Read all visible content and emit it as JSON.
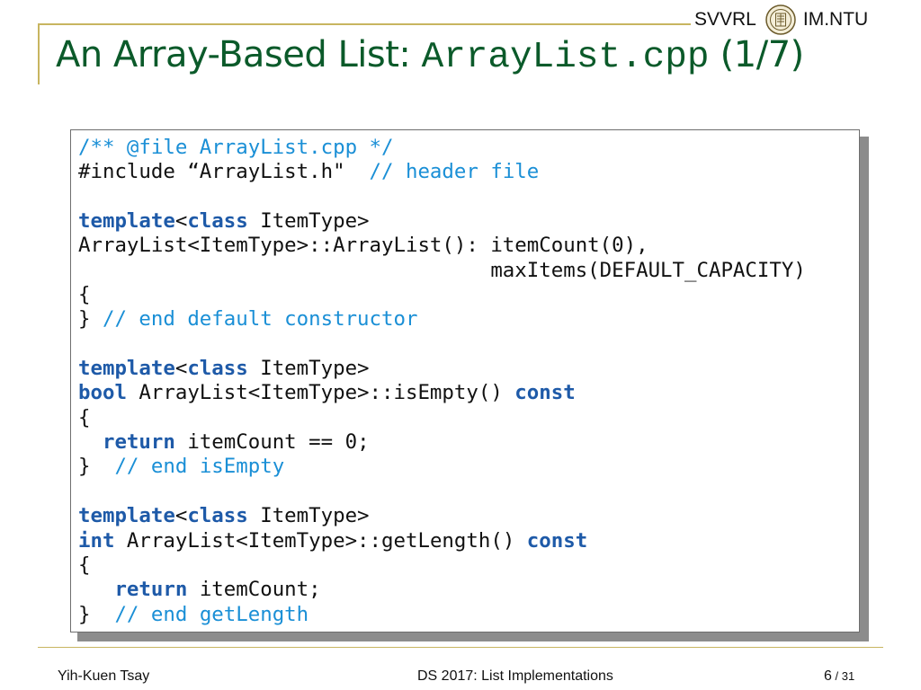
{
  "header": {
    "left_label": "SVVRL",
    "right_label": "IM.NTU",
    "logo_icon": "ntu-seal-icon"
  },
  "slide": {
    "title_prefix": "An Array-Based List: ",
    "title_code": "ArrayList.cpp",
    "title_suffix": " (1/7)"
  },
  "code": {
    "l1_comment": "/** @file ArrayList.cpp */",
    "l2_code": "#include “ArrayList.h\"  ",
    "l2_comment": "// header file",
    "l4_kw1": "template",
    "l4_mid": "<",
    "l4_kw2": "class",
    "l4_rest": " ItemType>",
    "l5": "ArrayList<ItemType>::ArrayList(): itemCount(0),",
    "l6": "                                  maxItems(DEFAULT_CAPACITY)",
    "l7": "{",
    "l8_code": "} ",
    "l8_comment": "// end default constructor",
    "l10_kw1": "template",
    "l10_mid": "<",
    "l10_kw2": "class",
    "l10_rest": " ItemType>",
    "l11_kw": "bool",
    "l11_mid": " ArrayList<ItemType>::isEmpty() ",
    "l11_kw2": "const",
    "l12": "{",
    "l13_indent": "  ",
    "l13_kw": "return",
    "l13_rest": " itemCount == 0;",
    "l14_code": "}  ",
    "l14_comment": "// end isEmpty",
    "l16_kw1": "template",
    "l16_mid": "<",
    "l16_kw2": "class",
    "l16_rest": " ItemType>",
    "l17_kw": "int",
    "l17_mid": " ArrayList<ItemType>::getLength() ",
    "l17_kw2": "const",
    "l18": "{",
    "l19_indent": "   ",
    "l19_kw": "return",
    "l19_rest": " itemCount;",
    "l20_code": "}  ",
    "l20_comment": "// end getLength"
  },
  "footer": {
    "author": "Yih-Kuen Tsay",
    "course": "DS 2017: List Implementations",
    "page_current": "6",
    "page_separator": " / ",
    "page_total": "31"
  }
}
